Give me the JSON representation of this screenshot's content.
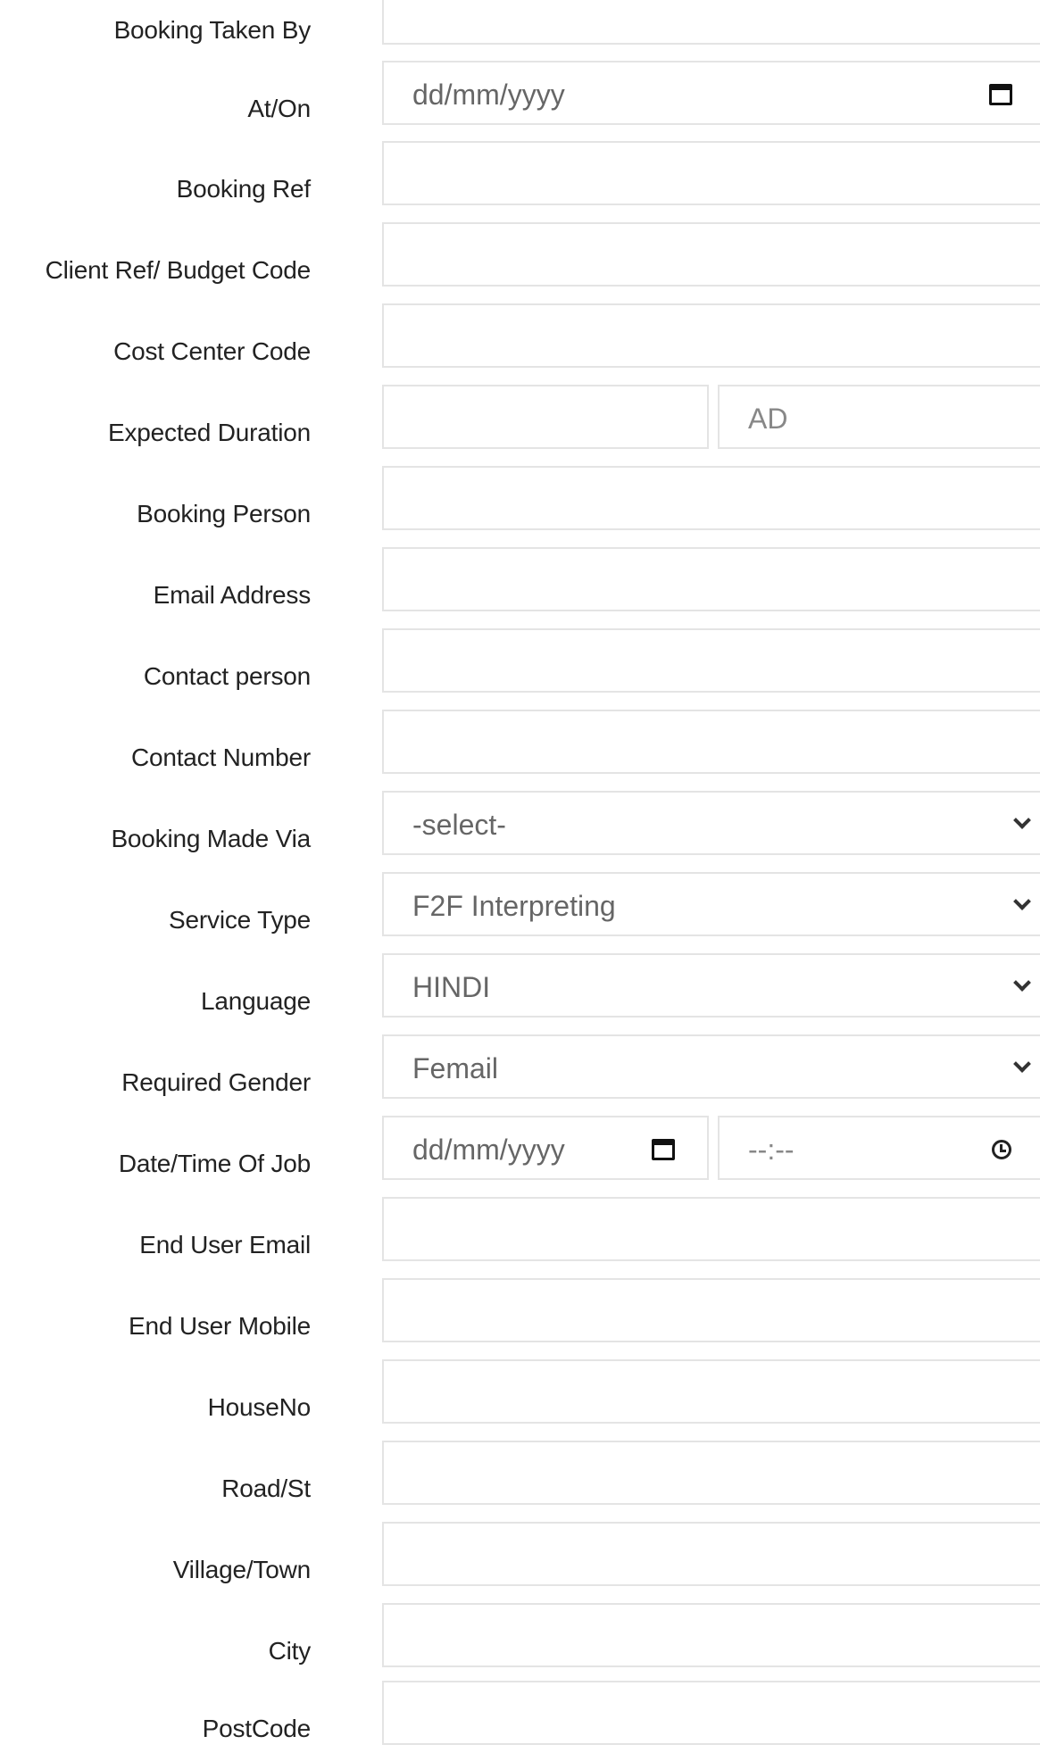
{
  "form": {
    "booking_taken_by": {
      "label": "Booking Taken By",
      "value": ""
    },
    "at_on": {
      "label": "At/On",
      "placeholder": "dd/mm/yyyy"
    },
    "booking_ref": {
      "label": "Booking Ref",
      "value": ""
    },
    "client_ref": {
      "label": "Client Ref/ Budget Code",
      "value": ""
    },
    "cost_center": {
      "label": "Cost Center Code",
      "value": ""
    },
    "expected_duration": {
      "label": "Expected Duration",
      "value": "",
      "unit_placeholder": "AD"
    },
    "booking_person": {
      "label": "Booking Person",
      "value": ""
    },
    "email_address": {
      "label": "Email Address",
      "value": ""
    },
    "contact_person": {
      "label": "Contact person",
      "value": ""
    },
    "contact_number": {
      "label": "Contact Number",
      "value": ""
    },
    "booking_made_via": {
      "label": "Booking Made Via",
      "selected": "-select-"
    },
    "service_type": {
      "label": "Service Type",
      "selected": "F2F Interpreting"
    },
    "language": {
      "label": "Language",
      "selected": "HINDI"
    },
    "required_gender": {
      "label": "Required Gender",
      "selected": "Femail"
    },
    "date_time_of_job": {
      "label": "Date/Time Of Job",
      "date_placeholder": "dd/mm/yyyy",
      "time_placeholder": "--:--"
    },
    "end_user_email": {
      "label": "End User Email",
      "value": ""
    },
    "end_user_mobile": {
      "label": "End User Mobile",
      "value": ""
    },
    "house_no": {
      "label": "HouseNo",
      "value": ""
    },
    "road_st": {
      "label": "Road/St",
      "value": ""
    },
    "village_town": {
      "label": "Village/Town",
      "value": ""
    },
    "city": {
      "label": "City",
      "value": ""
    },
    "postcode": {
      "label": "PostCode",
      "value": ""
    }
  },
  "icons": {
    "date": "calendar-icon",
    "dropdown": "chevron-down-icon",
    "time": "clock-icon"
  }
}
